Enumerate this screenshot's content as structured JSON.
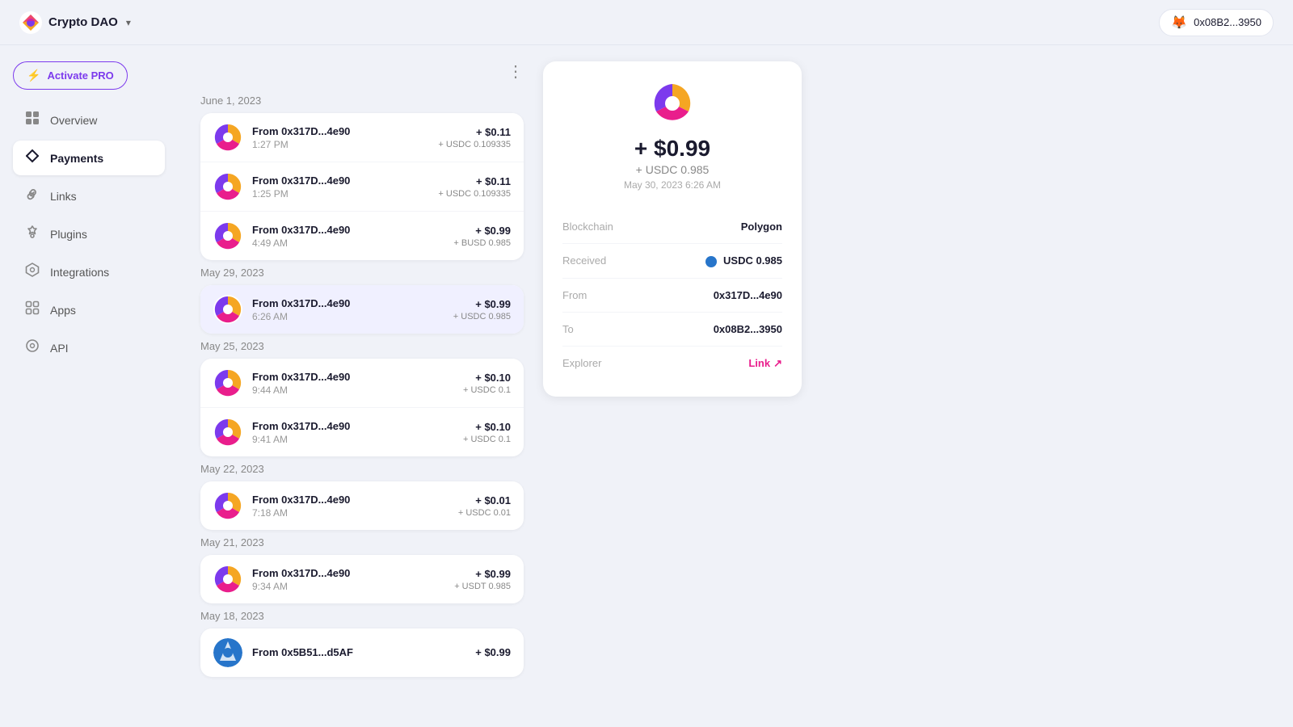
{
  "topbar": {
    "app_name": "Crypto DAO",
    "wallet_address": "0x08B2...3950",
    "fox_emoji": "🦊",
    "dropdown_icon": "▾"
  },
  "sidebar": {
    "activate_pro_label": "Activate PRO",
    "items": [
      {
        "id": "overview",
        "label": "Overview",
        "icon": "▬",
        "active": false
      },
      {
        "id": "payments",
        "label": "Payments",
        "icon": "⇄",
        "active": true
      },
      {
        "id": "links",
        "label": "Links",
        "icon": "◇",
        "active": false
      },
      {
        "id": "plugins",
        "label": "Plugins",
        "icon": "❖",
        "active": false
      },
      {
        "id": "integrations",
        "label": "Integrations",
        "icon": "✦",
        "active": false
      },
      {
        "id": "apps",
        "label": "Apps",
        "icon": "⬡",
        "active": false
      },
      {
        "id": "api",
        "label": "API",
        "icon": "◎",
        "active": false
      }
    ]
  },
  "payments": {
    "more_icon": "⋮",
    "groups": [
      {
        "date": "June 1, 2023",
        "transactions": [
          {
            "from": "From 0x317D...4e90",
            "time": "1:27 PM",
            "usd": "+ $0.11",
            "token": "+ USDC 0.109335",
            "selected": false
          },
          {
            "from": "From 0x317D...4e90",
            "time": "1:25 PM",
            "usd": "+ $0.11",
            "token": "+ USDC 0.109335",
            "selected": false
          },
          {
            "from": "From 0x317D...4e90",
            "time": "4:49 AM",
            "usd": "+ $0.99",
            "token": "+ BUSD 0.985",
            "selected": false
          }
        ]
      },
      {
        "date": "May 29, 2023",
        "transactions": [
          {
            "from": "From 0x317D...4e90",
            "time": "6:26 AM",
            "usd": "+ $0.99",
            "token": "+ USDC 0.985",
            "selected": true
          }
        ]
      },
      {
        "date": "May 25, 2023",
        "transactions": [
          {
            "from": "From 0x317D...4e90",
            "time": "9:44 AM",
            "usd": "+ $0.10",
            "token": "+ USDC 0.1",
            "selected": false
          },
          {
            "from": "From 0x317D...4e90",
            "time": "9:41 AM",
            "usd": "+ $0.10",
            "token": "+ USDC 0.1",
            "selected": false
          }
        ]
      },
      {
        "date": "May 22, 2023",
        "transactions": [
          {
            "from": "From 0x317D...4e90",
            "time": "7:18 AM",
            "usd": "+ $0.01",
            "token": "+ USDC 0.01",
            "selected": false
          }
        ]
      },
      {
        "date": "May 21, 2023",
        "transactions": [
          {
            "from": "From 0x317D...4e90",
            "time": "9:34 AM",
            "usd": "+ $0.99",
            "token": "+ USDT 0.985",
            "selected": false
          }
        ]
      },
      {
        "date": "May 18, 2023",
        "transactions": [
          {
            "from": "From 0x5B51...d5AF",
            "time": "",
            "usd": "+ $0.99",
            "token": "",
            "selected": false
          }
        ]
      }
    ]
  },
  "detail": {
    "amount": "+ $0.99",
    "token": "+ USDC 0.985",
    "date": "May 30, 2023 6:26 AM",
    "blockchain_label": "Blockchain",
    "blockchain_value": "Polygon",
    "received_label": "Received",
    "received_value": "USDC 0.985",
    "from_label": "From",
    "from_value": "0x317D...4e90",
    "to_label": "To",
    "to_value": "0x08B2...3950",
    "explorer_label": "Explorer",
    "explorer_value": "Link",
    "link_icon": "↗"
  }
}
